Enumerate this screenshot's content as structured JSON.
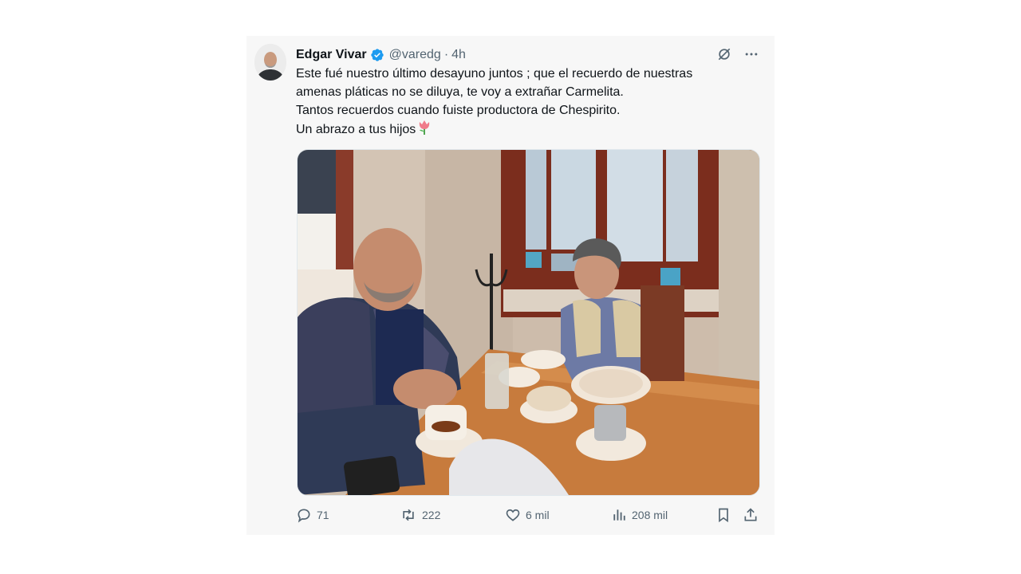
{
  "tweet": {
    "author_name": "Edgar Vivar",
    "handle": "@varedg",
    "separator": "·",
    "time": "4h",
    "verified": true,
    "text_lines": [
      "Este fué nuestro último desayuno juntos ; que el recuerdo de nuestras",
      "amenas pláticas no se diluya, te voy a extrañar Carmelita.",
      "Tantos recuerdos cuando fuiste productora de Chespirito.",
      "Un abrazo a tus hijos"
    ],
    "emoji": "tulip"
  },
  "metrics": {
    "replies": "71",
    "reposts": "222",
    "likes": "6 mil",
    "views": "208 mil"
  },
  "colors": {
    "verified": "#1d9bf0",
    "muted_text": "#536471",
    "card_background": "#f7f7f7"
  },
  "icons": [
    "grok-icon",
    "more-icon",
    "reply-icon",
    "repost-icon",
    "like-icon",
    "views-icon",
    "bookmark-icon",
    "share-icon"
  ]
}
